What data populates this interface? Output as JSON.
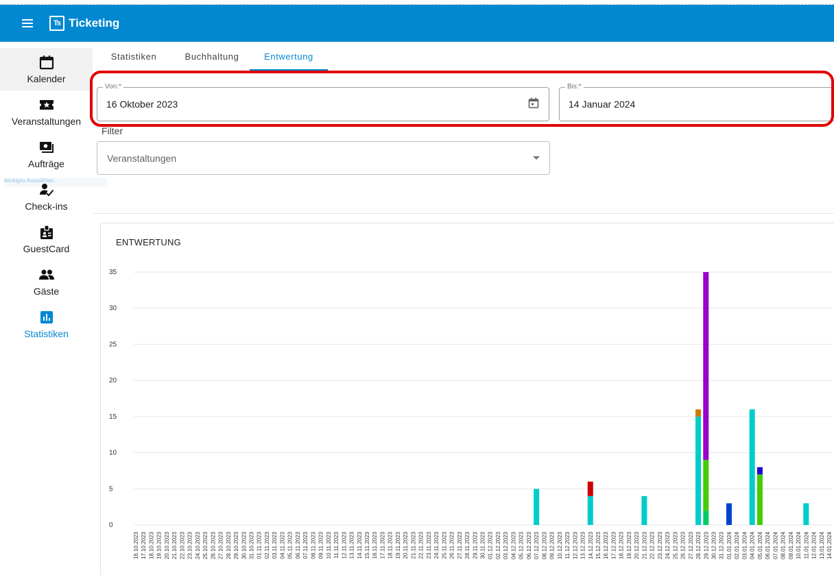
{
  "app": {
    "title": "Ticketing",
    "logo_text": "Ts"
  },
  "sidebar": {
    "items": [
      {
        "label": "Kalender",
        "icon": "calendar-icon"
      },
      {
        "label": "Veranstaltungen",
        "icon": "ticket-star-icon"
      },
      {
        "label": "Aufträge",
        "icon": "orders-icon"
      },
      {
        "label": "Check-ins",
        "icon": "person-check-icon"
      },
      {
        "label": "GuestCard",
        "icon": "badge-icon"
      },
      {
        "label": "Gäste",
        "icon": "people-icon"
      },
      {
        "label": "Statistiken",
        "icon": "bar-chart-icon"
      }
    ],
    "ghost_text": "tieckiges Auswählen..."
  },
  "tabs": [
    "Statistiken",
    "Buchhaltung",
    "Entwertung"
  ],
  "filters": {
    "von_label": "Von:*",
    "von_value": "16 Oktober 2023",
    "bis_label": "Bis:*",
    "bis_value": "14 Januar 2024",
    "filter_label": "Filter",
    "veranstaltungen_placeholder": "Veranstaltungen"
  },
  "colors": {
    "primary": "#0288d1",
    "highlight": "#e00000"
  },
  "chart_data": {
    "type": "bar",
    "title": "ENTWERTUNG",
    "ylim": [
      0,
      35
    ],
    "yticks": [
      0,
      5,
      10,
      15,
      20,
      25,
      30,
      35
    ],
    "grid": true,
    "categories": [
      "16.10.2023",
      "17.10.2023",
      "18.10.2023",
      "19.10.2023",
      "20.10.2023",
      "21.10.2023",
      "22.10.2023",
      "23.10.2023",
      "24.10.2023",
      "25.10.2023",
      "26.10.2023",
      "27.10.2023",
      "28.10.2023",
      "29.10.2023",
      "30.10.2023",
      "31.10.2023",
      "01.11.2023",
      "02.11.2023",
      "03.11.2023",
      "04.11.2023",
      "05.11.2023",
      "06.11.2023",
      "07.11.2023",
      "08.11.2023",
      "09.11.2023",
      "10.11.2023",
      "11.11.2023",
      "12.11.2023",
      "13.11.2023",
      "14.11.2023",
      "15.11.2023",
      "16.11.2023",
      "17.11.2023",
      "18.11.2023",
      "19.11.2023",
      "20.11.2023",
      "21.11.2023",
      "22.11.2023",
      "23.11.2023",
      "24.11.2023",
      "25.11.2023",
      "26.11.2023",
      "27.11.2023",
      "28.11.2023",
      "29.11.2023",
      "30.11.2023",
      "01.12.2023",
      "02.12.2023",
      "03.12.2023",
      "04.12.2023",
      "05.12.2023",
      "06.12.2023",
      "07.12.2023",
      "08.12.2023",
      "09.12.2023",
      "10.12.2023",
      "11.12.2023",
      "12.12.2023",
      "13.12.2023",
      "14.12.2023",
      "15.12.2023",
      "16.12.2023",
      "17.12.2023",
      "18.12.2023",
      "19.12.2023",
      "20.12.2023",
      "21.12.2023",
      "22.12.2023",
      "23.12.2023",
      "24.12.2023",
      "25.12.2023",
      "26.12.2023",
      "27.12.2023",
      "28.12.2023",
      "29.12.2023",
      "30.12.2023",
      "31.12.2023",
      "01.01.2024",
      "02.01.2024",
      "03.01.2024",
      "04.01.2024",
      "05.01.2024",
      "06.01.2024",
      "07.01.2024",
      "08.01.2024",
      "09.01.2024",
      "10.01.2024",
      "11.01.2024",
      "12.01.2024",
      "13.01.2024",
      "14.01.2024"
    ],
    "series": [
      {
        "color": "#00cccc",
        "values": {
          "07.12.2023": 5,
          "14.12.2023": 4,
          "21.12.2023": 4,
          "28.12.2023": 15,
          "04.01.2024": 16,
          "11.01.2024": 3
        }
      },
      {
        "color": "#cc0000",
        "values": {
          "14.12.2023": 2
        }
      },
      {
        "color": "#cc7a00",
        "values": {
          "28.12.2023": 1
        }
      },
      {
        "color": "#00cc66",
        "values": {
          "29.12.2023": 2
        }
      },
      {
        "color": "#44cc00",
        "values": {
          "29.12.2023": 7,
          "05.01.2024": 7
        }
      },
      {
        "color": "#9900cc",
        "values": {
          "29.12.2023": 26
        }
      },
      {
        "color": "#0044cc",
        "values": {
          "01.01.2024": 3
        }
      },
      {
        "color": "#2200cc",
        "values": {
          "05.01.2024": 1
        }
      }
    ]
  }
}
